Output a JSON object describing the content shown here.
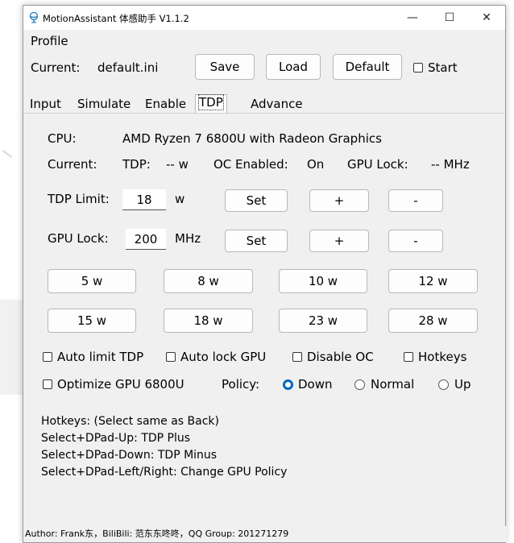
{
  "window": {
    "title": "MotionAssistant 体感助手 V1.1.2",
    "minimize": "—",
    "maximize": "☐",
    "close": "✕",
    "icon": "motion-app-icon"
  },
  "profile": {
    "heading": "Profile",
    "current_label": "Current:",
    "current_value": "default.ini",
    "save": "Save",
    "load": "Load",
    "default": "Default",
    "start": "Start"
  },
  "tabs": [
    "Input",
    "Simulate",
    "Enable",
    "TDP",
    "Advance"
  ],
  "active_tab": "TDP",
  "tdp": {
    "cpu_label": "CPU:",
    "cpu_value": "AMD Ryzen 7 6800U with Radeon Graphics",
    "current_label": "Current:",
    "tdp_label": "TDP:",
    "tdp_value": "-- w",
    "oc_label": "OC Enabled:",
    "oc_value": "On",
    "gpu_lock_label": "GPU Lock:",
    "gpu_lock_value": "-- MHz",
    "tdp_limit_label": "TDP Limit:",
    "tdp_limit_value": "18",
    "tdp_unit": "w",
    "set": "Set",
    "plus": "+",
    "minus": "-",
    "gpu_lock_row_label": "GPU Lock:",
    "gpu_lock_input": "200",
    "gpu_unit": "MHz",
    "presets": [
      "5 w",
      "8 w",
      "10 w",
      "12 w",
      "15 w",
      "18 w",
      "23 w",
      "28 w"
    ],
    "auto_limit": "Auto limit TDP",
    "auto_lock_gpu": "Auto lock GPU",
    "disable_oc": "Disable OC",
    "hotkeys_chk": "Hotkeys",
    "optimize_gpu": "Optimize GPU 6800U",
    "policy_label": "Policy:",
    "policy_options": [
      "Down",
      "Normal",
      "Up"
    ],
    "policy_selected": "Down",
    "hotkey_lines": [
      "Hotkeys: (Select same as Back)",
      "Select+DPad-Up: TDP Plus",
      "Select+DPad-Down: TDP Minus",
      "Select+DPad-Left/Right: Change GPU Policy"
    ]
  },
  "status_bar": "Author: Frank东，BiliBili: 范东东咚咚，QQ Group: 201271279",
  "colors": {
    "accent": "#0067c0",
    "window_bg": "#f0f0f0"
  }
}
